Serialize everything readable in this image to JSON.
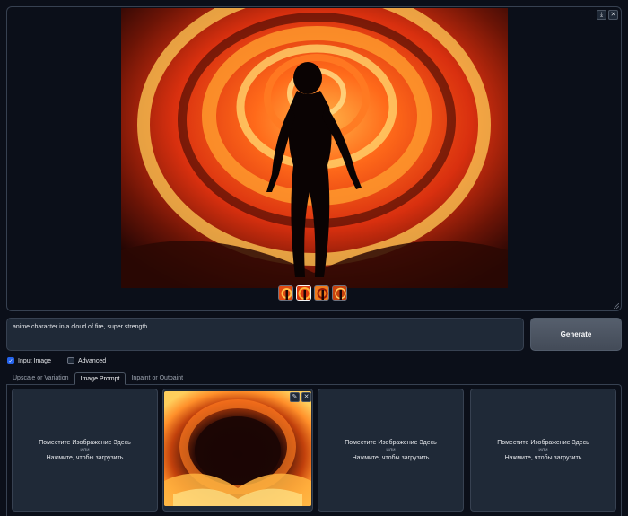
{
  "gallery": {
    "tools": {
      "download": "⤓",
      "close": "✕"
    }
  },
  "prompt": {
    "value": "anime character in a cloud of fire, super strength"
  },
  "generate": {
    "label": "Generate"
  },
  "options": {
    "input_image": {
      "label": "Input Image",
      "checked": true
    },
    "advanced": {
      "label": "Advanced",
      "checked": false
    }
  },
  "tabs": [
    {
      "label": "Upscale or Variation",
      "active": false
    },
    {
      "label": "Image Prompt",
      "active": true
    },
    {
      "label": "Inpaint or Outpaint",
      "active": false
    }
  ],
  "upload": {
    "drop_text": "Поместите Изображение Здесь",
    "or_text": "- или -",
    "click_text": "Нажмите, чтобы загрузить"
  },
  "image_card": {
    "edit": "✎",
    "close": "✕"
  },
  "colors": {
    "background": "#0b0f19",
    "panel": "#1f2937",
    "border": "#374151",
    "generate": "#4b5563",
    "checkbox_on": "#2563eb"
  }
}
